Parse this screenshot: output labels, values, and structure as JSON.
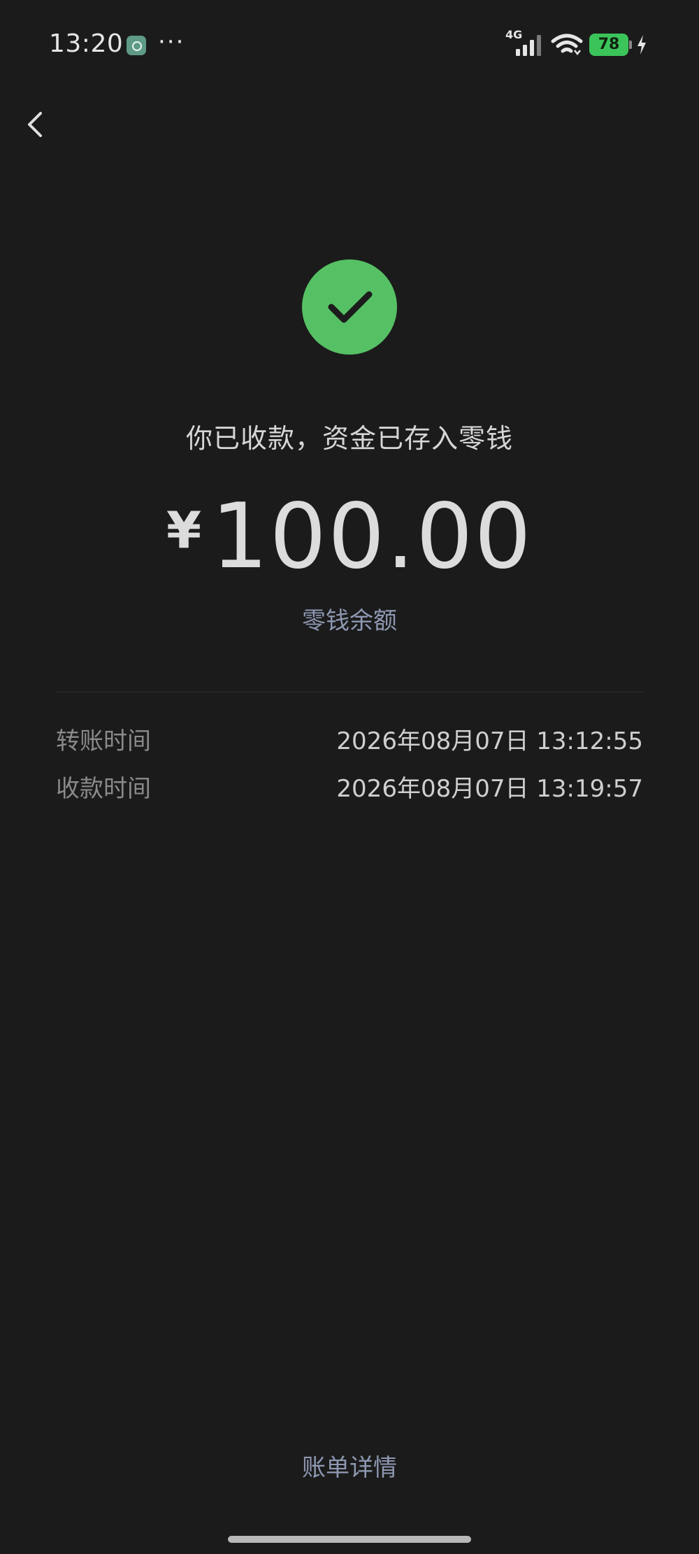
{
  "status_bar": {
    "time": "13:20",
    "dots": "···",
    "network": "4G",
    "battery": "78"
  },
  "main": {
    "message": "你已收款，资金已存入零钱",
    "currency_symbol": "¥",
    "amount": "100.00",
    "balance_link": "零钱余额"
  },
  "details": {
    "rows": [
      {
        "label": "转账时间",
        "value": "2026年08月07日 13:12:55"
      },
      {
        "label": "收款时间",
        "value": "2026年08月07日 13:19:57"
      }
    ]
  },
  "footer": {
    "bill_details": "账单详情"
  },
  "colors": {
    "background": "#1b1b1b",
    "success_green": "#56c164",
    "link_blue_gray": "#8e98b2",
    "battery_green": "#3bc45a"
  },
  "icons": {
    "back": "chevron-left-icon",
    "success": "check-circle-icon",
    "signal": "signal-icon",
    "wifi": "wifi-icon",
    "battery": "battery-icon",
    "charging": "charging-bolt-icon",
    "notification_app": "app-notification-icon"
  }
}
